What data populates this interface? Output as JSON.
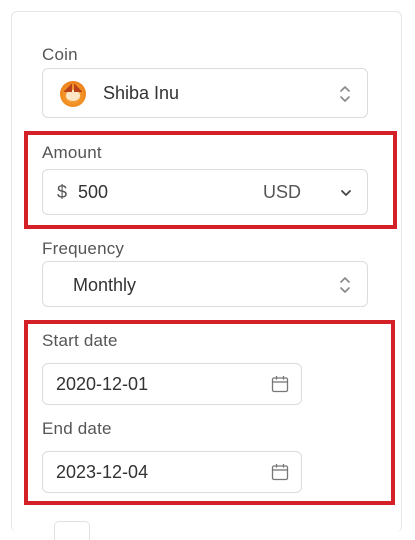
{
  "coin": {
    "label": "Coin",
    "value": "Shiba Inu",
    "icon": "shiba-inu-coin-icon"
  },
  "amount": {
    "label": "Amount",
    "prefix": "$",
    "value": "500",
    "currency": "USD"
  },
  "frequency": {
    "label": "Frequency",
    "value": "Monthly"
  },
  "start_date": {
    "label": "Start date",
    "value": "2020-12-01"
  },
  "end_date": {
    "label": "End date",
    "value": "2023-12-04"
  },
  "colors": {
    "highlight": "#d42027",
    "border": "#dcdcdc",
    "text": "#333333",
    "label": "#555555"
  }
}
